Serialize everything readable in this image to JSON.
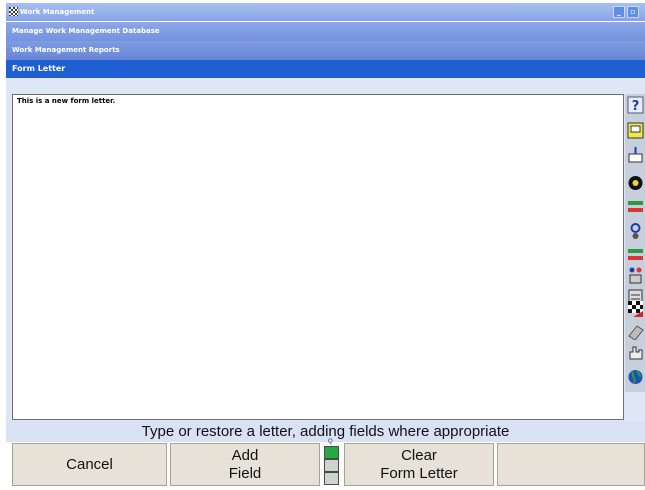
{
  "window": {
    "title": "Work Management"
  },
  "breadcrumb": {
    "level1": "Manage Work Management Database",
    "level2": "Work Management Reports",
    "level3": "Form Letter"
  },
  "letter": {
    "text": "This is a new form letter."
  },
  "status": {
    "message": "Type or restore a letter, adding fields where appropriate"
  },
  "softkeys": {
    "cancel": "Cancel",
    "add_field": [
      "Add",
      "Field"
    ],
    "clear": [
      "Clear",
      "Form Letter"
    ],
    "empty": ""
  },
  "indicator": {
    "label": "Q",
    "segments": [
      "on",
      "off",
      "off"
    ]
  },
  "toolbar_icons": [
    "help-icon",
    "screen-icon",
    "alignment-icon",
    "wheel-icon",
    "measure-icon",
    "steering-icon",
    "readings-icon",
    "sensor-icon",
    "print-icon",
    "flag-icon",
    "eraser-icon",
    "hand-icon",
    "globe-icon"
  ],
  "colors": {
    "active_bar": "#1f5fd1",
    "softkey_bg": "#e7e2d8",
    "indicator_on": "#28a745"
  }
}
